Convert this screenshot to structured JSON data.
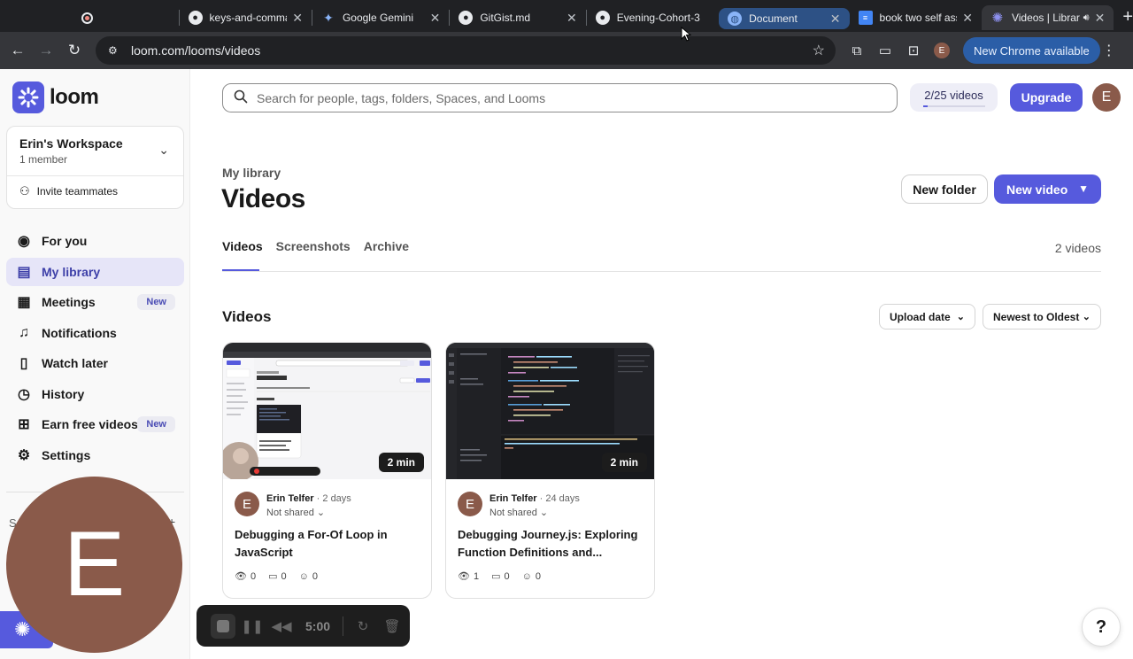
{
  "browser": {
    "tabs": [
      {
        "title": "",
        "icon": "record-icon"
      },
      {
        "title": "keys-and-comma",
        "icon": "github-icon"
      },
      {
        "title": "Google Gemini",
        "icon": "gemini-icon"
      },
      {
        "title": "GitGist.md",
        "icon": "github-icon"
      },
      {
        "title": "Evening-Cohort-3",
        "icon": "github-icon"
      },
      {
        "title": "Document",
        "icon": "globe-icon"
      },
      {
        "title": "book two self ass",
        "icon": "docs-icon"
      },
      {
        "title": "Videos | Librar",
        "icon": "loom-icon"
      }
    ],
    "url": "loom.com/looms/videos",
    "update_label": "New Chrome available",
    "profile_initial": "E"
  },
  "sidebar": {
    "brand": "loom",
    "workspace": {
      "name": "Erin's Workspace",
      "members": "1 member",
      "invite": "Invite teammates"
    },
    "items": [
      {
        "label": "For you",
        "icon": "person-icon",
        "badge": ""
      },
      {
        "label": "My library",
        "icon": "library-icon",
        "badge": ""
      },
      {
        "label": "Meetings",
        "icon": "calendar-icon",
        "badge": "New"
      },
      {
        "label": "Notifications",
        "icon": "bell-icon",
        "badge": ""
      },
      {
        "label": "Watch later",
        "icon": "bookmark-icon",
        "badge": ""
      },
      {
        "label": "History",
        "icon": "clock-icon",
        "badge": ""
      },
      {
        "label": "Earn free videos",
        "icon": "gift-icon",
        "badge": "New"
      },
      {
        "label": "Settings",
        "icon": "gear-icon",
        "badge": ""
      }
    ],
    "spaces_fragment": "S"
  },
  "header": {
    "search_placeholder": "Search for people, tags, folders, Spaces, and Looms",
    "quota": "2/25 videos",
    "quota_used": 2,
    "quota_total": 25,
    "upgrade": "Upgrade",
    "avatar_initial": "E"
  },
  "main": {
    "breadcrumb": "My library",
    "title": "Videos",
    "new_folder": "New folder",
    "new_video": "New video",
    "tabs": [
      "Videos",
      "Screenshots",
      "Archive"
    ],
    "count": "2 videos",
    "section": "Videos",
    "sort_field": "Upload date",
    "sort_order": "Newest to Oldest",
    "videos": [
      {
        "duration": "2 min",
        "author": "Erin Telfer",
        "age": "2 days",
        "sharing": "Not shared",
        "title": "Debugging a For-Of Loop in JavaScript",
        "views": "0",
        "comments": "0",
        "reactions": "0",
        "theme": "light"
      },
      {
        "duration": "2 min",
        "author": "Erin Telfer",
        "age": "24 days",
        "sharing": "Not shared",
        "title": "Debugging Journey.js: Exploring Function Definitions and...",
        "views": "1",
        "comments": "0",
        "reactions": "0",
        "theme": "dark"
      }
    ]
  },
  "recorder": {
    "camera_initial": "E",
    "time": "5:00"
  },
  "help_label": "?"
}
